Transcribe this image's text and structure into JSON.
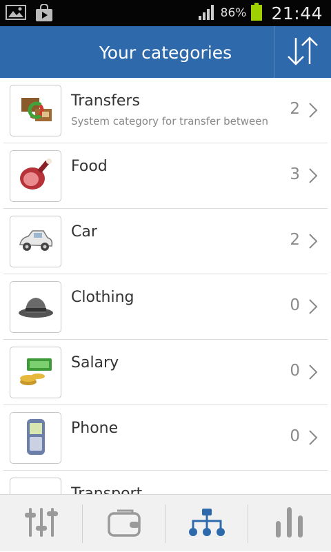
{
  "status_bar": {
    "battery_percent": "86%",
    "time": "21:44",
    "icons": [
      "gallery-icon",
      "store-bag-icon",
      "signal-icon",
      "battery-icon"
    ]
  },
  "header": {
    "title": "Your categories",
    "sort_icon": "sort-arrows-icon"
  },
  "colors": {
    "accent": "#2e6aab",
    "tab_active": "#2e6aab",
    "tab_inactive": "#9a9a9a"
  },
  "categories": [
    {
      "name": "Transfers",
      "subtitle": "System category for transfer between",
      "count": "2",
      "icon": "transfers-icon"
    },
    {
      "name": "Food",
      "subtitle": "",
      "count": "3",
      "icon": "ham-icon"
    },
    {
      "name": "Car",
      "subtitle": "",
      "count": "2",
      "icon": "car-icon"
    },
    {
      "name": "Clothing",
      "subtitle": "",
      "count": "0",
      "icon": "hat-icon"
    },
    {
      "name": "Salary",
      "subtitle": "",
      "count": "0",
      "icon": "money-icon"
    },
    {
      "name": "Phone",
      "subtitle": "",
      "count": "0",
      "icon": "mobile-phone-icon"
    },
    {
      "name": "Transport",
      "subtitle": "",
      "count": "",
      "icon": "transport-icon"
    }
  ],
  "tabs": [
    {
      "name": "settings-sliders",
      "icon": "sliders-icon",
      "active": false
    },
    {
      "name": "wallet",
      "icon": "wallet-icon",
      "active": false
    },
    {
      "name": "categories",
      "icon": "hierarchy-icon",
      "active": true
    },
    {
      "name": "statistics",
      "icon": "bar-chart-icon",
      "active": false
    }
  ]
}
